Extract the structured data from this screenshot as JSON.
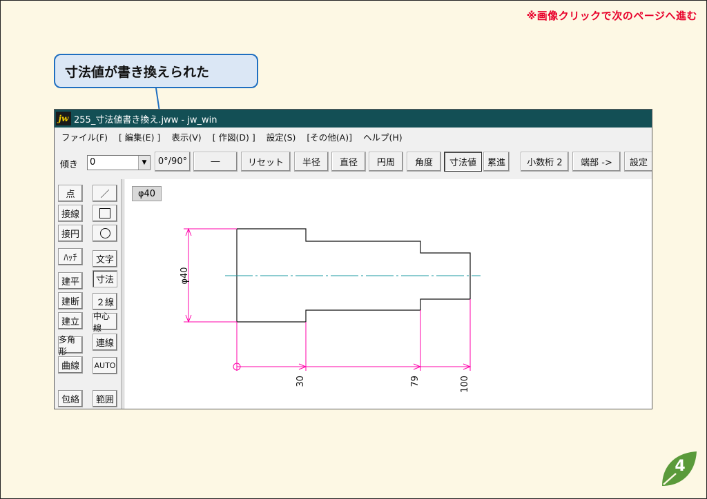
{
  "notice": "※画像クリックで次のページへ進む",
  "callout": "寸法値が書き換えられた",
  "window": {
    "icon": "jw",
    "title": "255_寸法値書き換え.jww - jw_win"
  },
  "menu": [
    "ファイル(F)",
    "[ 編集(E) ]",
    "表示(V)",
    "[ 作図(D) ]",
    "設定(S)",
    "[その他(A)]",
    "ヘルプ(H)"
  ],
  "toolbar": {
    "tilt_label": "傾き",
    "tilt_value": "0",
    "rotate": "0°/90°",
    "dash": "―",
    "reset": "リセット",
    "radius": "半径",
    "diameter": "直径",
    "circumference": "円周",
    "angle": "角度",
    "dim_value": "寸法値",
    "cumulative": "累進",
    "decimal": "小数桁 2",
    "end": "端部 ->",
    "settings": "設定"
  },
  "left_tools": {
    "point": "点",
    "line_icon": "／",
    "tangent_line": "接線",
    "tangent_circle": "接円",
    "hatch": "ﾊｯﾁ",
    "text": "文字",
    "arch_plan": "建平",
    "dimension": "寸法",
    "arch_section": "建断",
    "double_line": "２線",
    "arch_elev": "建立",
    "center_line": "中心線",
    "polygon": "多角形",
    "cont_line": "連線",
    "curve": "曲線",
    "auto": "AUTO",
    "envelope": "包絡",
    "range": "範囲"
  },
  "canvas": {
    "dim_tag": "φ40",
    "dim_vertical": "φ40",
    "dim_30": "30",
    "dim_79": "79",
    "dim_100": "100"
  },
  "page_number": "4",
  "colors": {
    "notice": "#e8002a",
    "titlebar": "#134f55",
    "callout_border": "#1f6fc0",
    "dimension_line": "#ff00aa",
    "center_line": "#1a9aa0"
  }
}
